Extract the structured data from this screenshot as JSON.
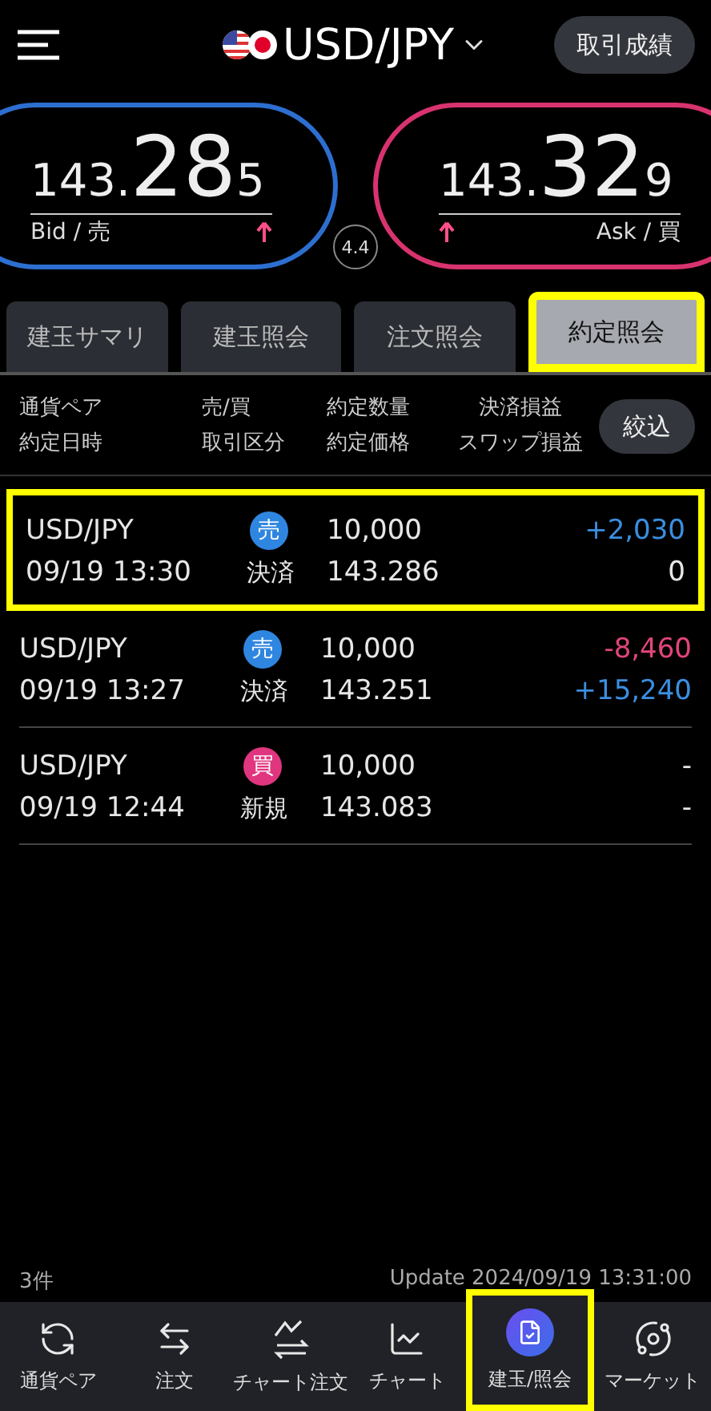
{
  "header": {
    "pair": "USD/JPY",
    "results_button": "取引成績"
  },
  "quotes": {
    "bid": {
      "head": "143.",
      "big": "28",
      "pip": "5",
      "label": "Bid / 売",
      "arrow": {
        "kind": "up"
      }
    },
    "ask": {
      "head": "143.",
      "big": "32",
      "pip": "9",
      "label": "Ask / 買",
      "arrow": {
        "kind": "up"
      }
    },
    "spread": "4.4"
  },
  "tabs": [
    {
      "label": "建玉サマリ",
      "selected": false,
      "highlighted": false
    },
    {
      "label": "建玉照会",
      "selected": false,
      "highlighted": false
    },
    {
      "label": "注文照会",
      "selected": false,
      "highlighted": false
    },
    {
      "label": "約定照会",
      "selected": true,
      "highlighted": true
    }
  ],
  "columns": {
    "pair": "通貨ペア",
    "time": "約定日時",
    "side": "売/買",
    "type": "取引区分",
    "qty": "約定数量",
    "price": "約定価格",
    "pl": "決済損益",
    "swap": "スワップ損益"
  },
  "filter_button": "絞込",
  "trades": [
    {
      "pair": "USD/JPY",
      "time": "09/19 13:30",
      "kind": "sell",
      "side_label": "売",
      "type": "決済",
      "qty": "10,000",
      "price": "143.286",
      "pl": {
        "text": "+2,030",
        "kind": "gain"
      },
      "swap": {
        "text": "0",
        "kind": "neutral"
      },
      "highlighted": true
    },
    {
      "pair": "USD/JPY",
      "time": "09/19 13:27",
      "kind": "sell",
      "side_label": "売",
      "type": "決済",
      "qty": "10,000",
      "price": "143.251",
      "pl": {
        "text": "-8,460",
        "kind": "loss"
      },
      "swap": {
        "text": "+15,240",
        "kind": "gain"
      },
      "highlighted": false
    },
    {
      "pair": "USD/JPY",
      "time": "09/19 12:44",
      "kind": "buy",
      "side_label": "買",
      "type": "新規",
      "qty": "10,000",
      "price": "143.083",
      "pl": {
        "text": "-",
        "kind": "neutral"
      },
      "swap": {
        "text": "-",
        "kind": "neutral"
      },
      "highlighted": false
    }
  ],
  "count": "3件",
  "updated": "Update 2024/09/19 13:31:00",
  "nav": [
    {
      "label": "通貨ペア",
      "kind": "pairs",
      "selected": false,
      "highlighted": false
    },
    {
      "label": "注文",
      "kind": "order",
      "selected": false,
      "highlighted": false
    },
    {
      "label": "チャート注文",
      "kind": "chart_order",
      "selected": false,
      "highlighted": false
    },
    {
      "label": "チャート",
      "kind": "chart",
      "selected": false,
      "highlighted": false
    },
    {
      "label": "建玉/照会",
      "kind": "positions",
      "selected": true,
      "highlighted": true
    },
    {
      "label": "マーケット",
      "kind": "market",
      "selected": false,
      "highlighted": false
    }
  ]
}
